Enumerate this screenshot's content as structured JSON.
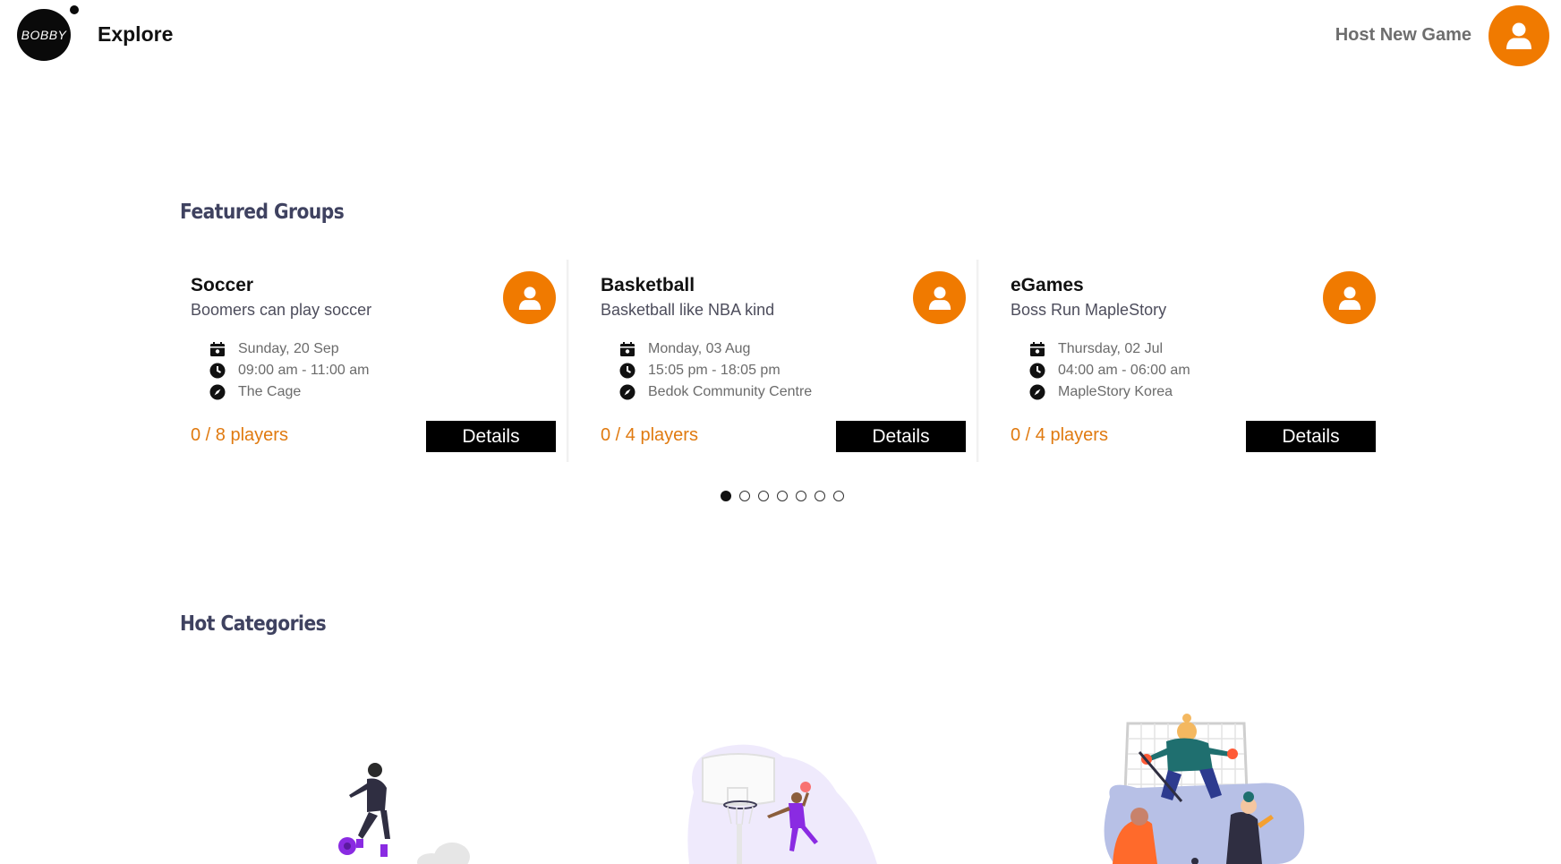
{
  "header": {
    "logo_text": "BOBBY",
    "title": "Explore",
    "host_link": "Host New Game"
  },
  "featured": {
    "title": "Featured Groups",
    "cards": [
      {
        "title": "Soccer",
        "subtitle": "Boomers can play soccer",
        "date": "Sunday, 20 Sep",
        "time": "09:00 am - 11:00 am",
        "location": "The Cage",
        "players": "0 / 8 players",
        "button": "Details"
      },
      {
        "title": "Basketball",
        "subtitle": "Basketball like NBA kind",
        "date": "Monday, 03 Aug",
        "time": "15:05 pm - 18:05 pm",
        "location": "Bedok Community Centre",
        "players": "0 / 4 players",
        "button": "Details"
      },
      {
        "title": "eGames",
        "subtitle": "Boss Run MapleStory",
        "date": "Thursday, 02 Jul",
        "time": "04:00 am - 06:00 am",
        "location": "MapleStory Korea",
        "players": "0 / 4 players",
        "button": "Details"
      }
    ],
    "pagination": {
      "total": 7,
      "active": 1
    }
  },
  "categories": {
    "title": "Hot Categories",
    "items": [
      "soccer-illustration",
      "basketball-illustration",
      "hockey-illustration"
    ]
  },
  "colors": {
    "accent": "#f07a00",
    "players_text": "#e07a10",
    "heading": "#3f4260",
    "button_bg": "#000000"
  },
  "icons": {
    "profile": "user-icon",
    "date": "calendar-icon",
    "time": "clock-icon",
    "location": "compass-icon"
  }
}
